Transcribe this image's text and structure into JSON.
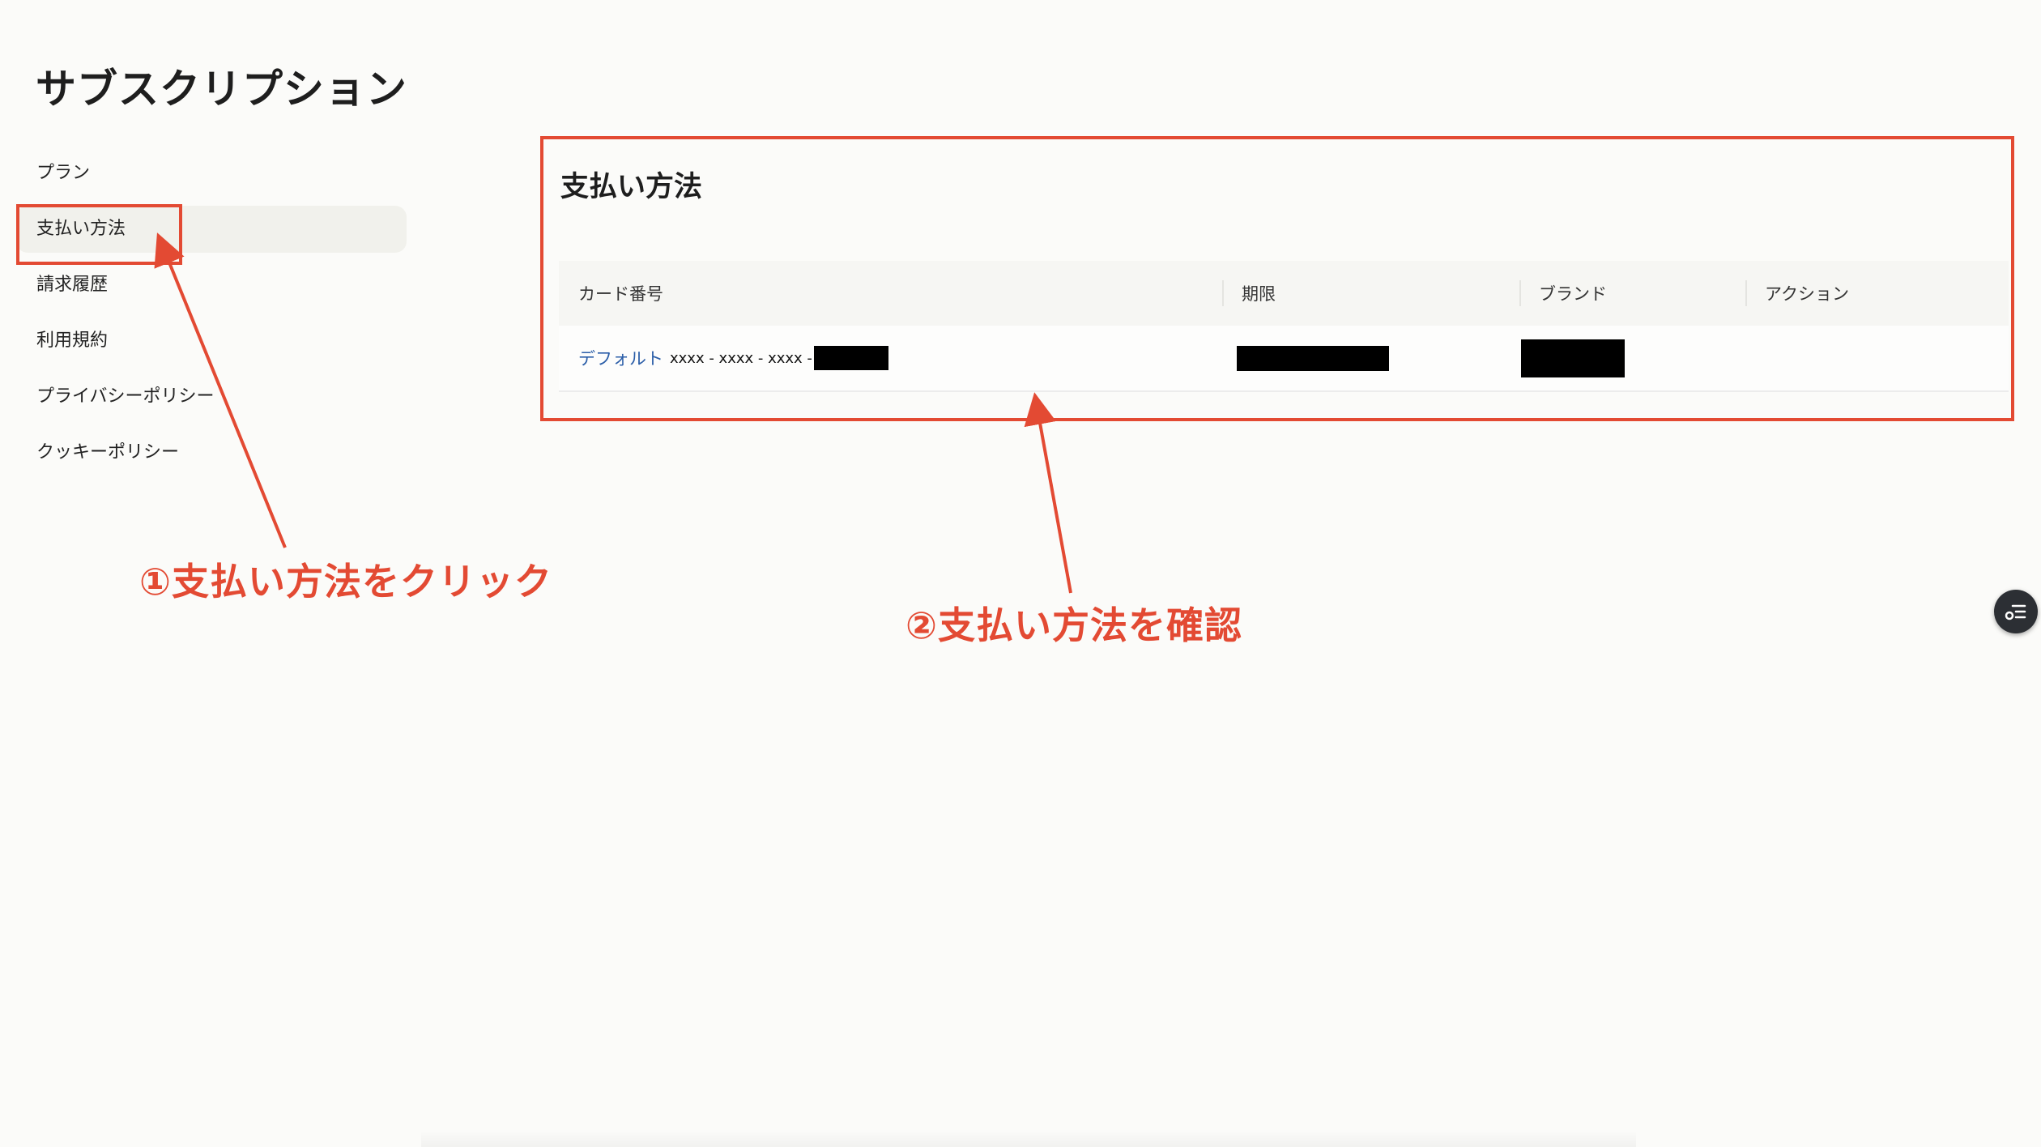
{
  "page": {
    "title": "サブスクリプション"
  },
  "sidebar": {
    "items": [
      {
        "label": "プラン"
      },
      {
        "label": "支払い方法",
        "active": true
      },
      {
        "label": "請求履歴"
      },
      {
        "label": "利用規約"
      },
      {
        "label": "プライバシーポリシー"
      },
      {
        "label": "クッキーポリシー"
      }
    ]
  },
  "main": {
    "section_title": "支払い方法",
    "table": {
      "headers": [
        "カード番号",
        "期限",
        "ブランド",
        "アクション"
      ],
      "rows": [
        {
          "default_label": "デフォルト",
          "card_number_masked": "xxxx - xxxx - xxxx -",
          "card_last4": "[redacted]",
          "expiry": "[redacted]",
          "brand": "[redacted]",
          "action": ""
        }
      ]
    }
  },
  "annotations": {
    "step1": "①支払い方法をクリック",
    "step2": "②支払い方法を確認",
    "color": "#e34a33"
  },
  "floating_button": {
    "icon": "list-icon"
  },
  "colors": {
    "background": "#fbfbf9",
    "active_item_bg": "#f1f1ec",
    "link": "#2b5ea8",
    "table_header_bg": "#f6f6f3"
  }
}
